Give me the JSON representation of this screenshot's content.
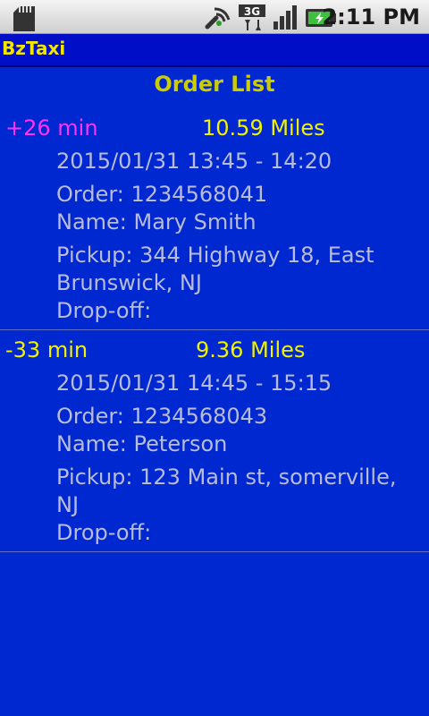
{
  "status_bar": {
    "time": "2:11 PM",
    "network_label": "3G",
    "icons": [
      "sd-card-icon",
      "signal-wifi-icon",
      "3g-data-icon",
      "cell-signal-icon",
      "battery-charging-icon"
    ]
  },
  "app": {
    "title": "BzTaxi"
  },
  "page": {
    "heading": "Order List"
  },
  "colors": {
    "background": "#0028d0",
    "title_bar": "#000ec8",
    "title_text": "#f2e600",
    "heading": "#cccc00",
    "miles": "#f2f200",
    "detail_text": "#b8bcd8",
    "late_delay": "#ff33ff",
    "early_delay": "#f2f200"
  },
  "orders": [
    {
      "delay": "+26 min",
      "delay_color": "#ff33ff",
      "miles": "10.59 Miles",
      "time_window": "2015/01/31 13:45 - 14:20",
      "order": "Order:  1234568041",
      "name": "Name:  Mary Smith",
      "pickup": "Pickup: 344 Highway 18, East Brunswick, NJ",
      "dropoff": "Drop-off:"
    },
    {
      "delay": "-33 min",
      "delay_color": "#f2f200",
      "miles": "9.36 Miles",
      "time_window": "2015/01/31 14:45 - 15:15",
      "order": "Order:  1234568043",
      "name": "Name:  Peterson",
      "pickup": "Pickup: 123 Main st, somerville, NJ",
      "dropoff": "Drop-off:"
    }
  ]
}
